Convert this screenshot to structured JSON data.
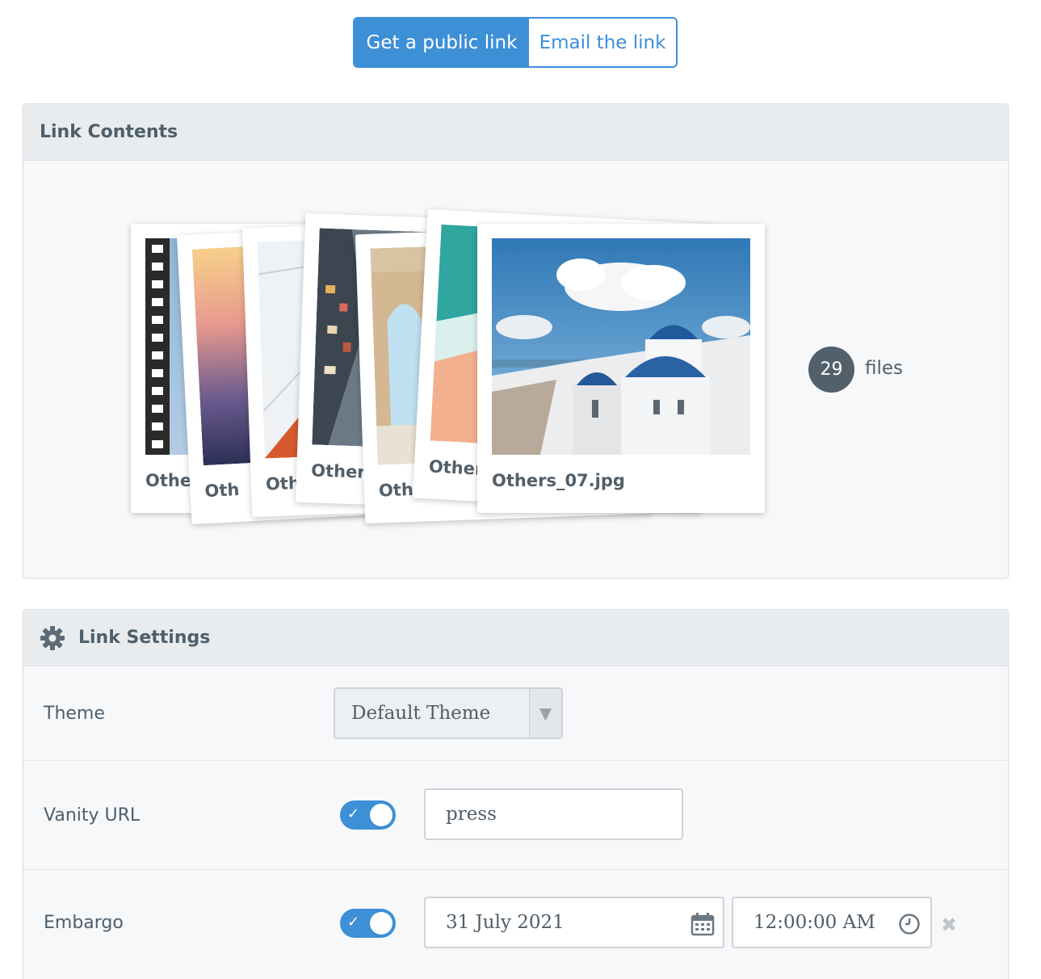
{
  "tabs": {
    "public_link": "Get a public link",
    "email_link": "Email the link"
  },
  "link_contents": {
    "title": "Link Contents",
    "cards": [
      {
        "caption": "Other"
      },
      {
        "caption": "Oth"
      },
      {
        "caption": "Othe"
      },
      {
        "caption": "Others"
      },
      {
        "caption": "Oth"
      },
      {
        "caption": "Others"
      },
      {
        "caption": "Others_07.jpg"
      }
    ],
    "file_count": "29",
    "file_label": "files"
  },
  "link_settings": {
    "title": "Link Settings",
    "theme": {
      "label": "Theme",
      "value": "Default Theme"
    },
    "vanity": {
      "label": "Vanity URL",
      "enabled": true,
      "value": "press"
    },
    "embargo": {
      "label": "Embargo",
      "enabled": true,
      "date": "31 July 2021",
      "time": "12:00:00 AM"
    }
  },
  "colors": {
    "accent": "#3d8fd6",
    "badge": "#52606b",
    "panel_header": "#e8ecef"
  },
  "icons": [
    "gear-icon",
    "calendar-icon",
    "clock-icon",
    "close-icon",
    "chevron-down-icon",
    "check-icon"
  ]
}
